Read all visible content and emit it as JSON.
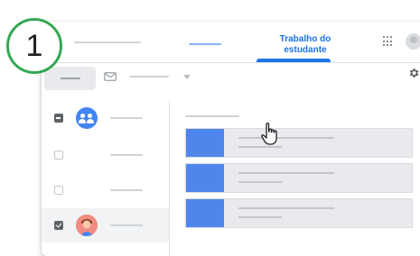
{
  "step_number": "1",
  "header": {
    "tab_label": "Trabalho do estudante"
  },
  "icons": {
    "apps": "apps-grid-icon",
    "account": "account-avatar-icon",
    "mail": "mail-icon",
    "dropdown": "chevron-down-icon",
    "settings": "gear-icon",
    "group": "group-icon",
    "student": "student-avatar-icon",
    "pointer": "hand-pointer-icon"
  },
  "sidebar": {
    "rows": [
      {
        "checkbox": "indeterminate",
        "avatar": "group"
      },
      {
        "checkbox": "unchecked",
        "avatar": "none"
      },
      {
        "checkbox": "unchecked",
        "avatar": "none"
      },
      {
        "checkbox": "checked",
        "avatar": "student"
      }
    ]
  },
  "colors": {
    "accent": "#1a73e8",
    "badge_ring": "#34a853",
    "card_thumb": "#4f86ec",
    "group_avatar": "#4285f4"
  }
}
